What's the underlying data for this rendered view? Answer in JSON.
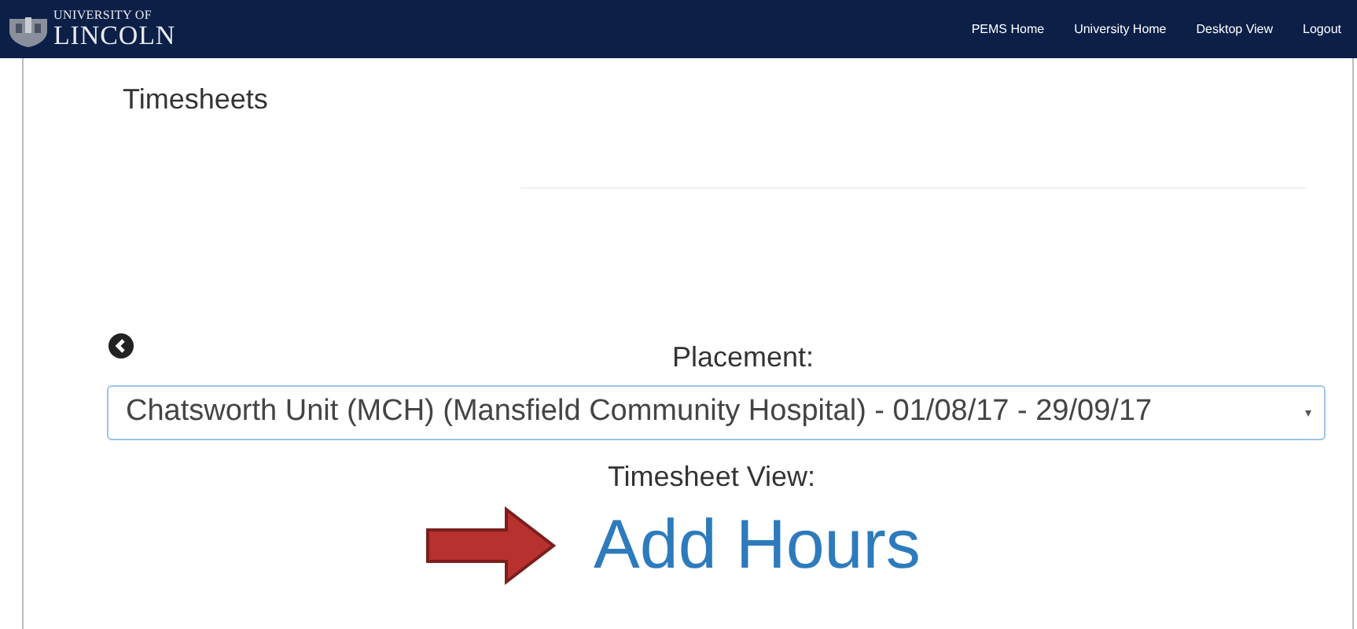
{
  "header": {
    "logo_line_1": "UNIVERSITY OF",
    "logo_line_2": "LINCOLN",
    "nav_links": [
      "PEMS Home",
      "University Home",
      "Desktop View",
      "Logout"
    ]
  },
  "page_title": "Timesheets",
  "placement_label": "Placement:",
  "placement_select": {
    "value": "Chatsworth Unit (MCH) (Mansfield Community Hospital) - 01/08/17 - 29/09/17"
  },
  "view_label": "Timesheet View:",
  "add_hours_link": "Add Hours"
}
